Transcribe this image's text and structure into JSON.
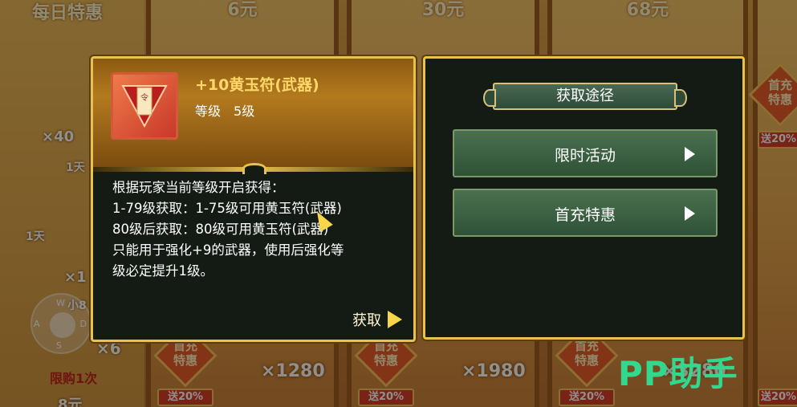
{
  "background": {
    "daily_deal_title": "每日特惠",
    "prices": [
      "6元",
      "30元",
      "68元"
    ],
    "left_counts": [
      "×40",
      "×1"
    ],
    "day_labels": [
      "1天",
      "1天"
    ],
    "limit": "限购1次",
    "bottom_price": "8元",
    "badges": [
      {
        "text": "首充\n特惠"
      },
      {
        "text": "首充\n特惠"
      },
      {
        "text": "首充\n特惠"
      },
      {
        "text": "首充\n特惠"
      }
    ],
    "sales": [
      "送20%",
      "送20%",
      "送20%",
      "送20%",
      "送20%"
    ],
    "amounts": [
      "×1280",
      "×1980",
      "×3280",
      "×6"
    ],
    "joystick": {
      "w": "W",
      "a": "A",
      "s": "S",
      "d": "D"
    },
    "partial_label": "小8"
  },
  "item": {
    "name": "+10黄玉符(武器)",
    "level_label": "等级",
    "level_value": "5级",
    "description": [
      "根据玩家当前等级开启获得：",
      "1-79级获取：1-75级可用黄玉符(武器)",
      "80级后获取：80级可用黄玉符(武器)",
      "只能用于强化+9的武器，使用后强化等",
      "级必定提升1级。"
    ],
    "obtain_label": "获取"
  },
  "source": {
    "title": "获取途径",
    "options": [
      {
        "label": "限时活动"
      },
      {
        "label": "首充特惠"
      }
    ]
  },
  "watermark": "PP助手",
  "colors": {
    "gold_border": "#e8c24a",
    "panel_bg": "#141a14",
    "item_name": "#ffd66a",
    "option_bg": "#3f6446"
  }
}
